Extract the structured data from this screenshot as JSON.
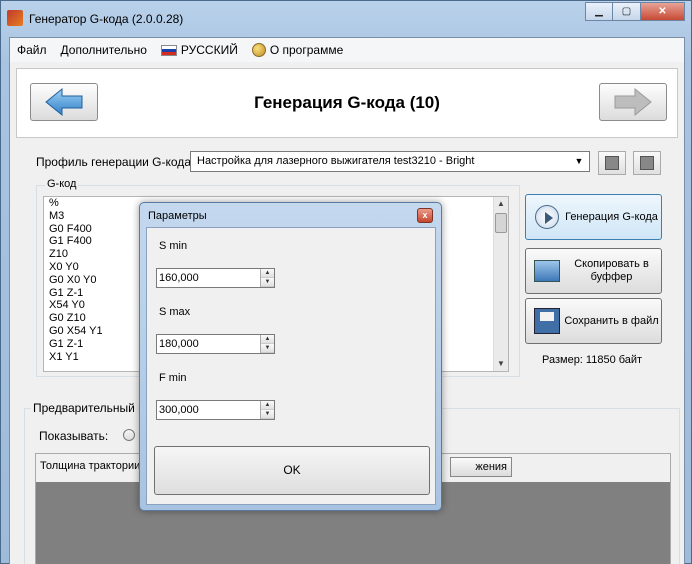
{
  "window": {
    "title": "Генератор G-кода (2.0.0.28)",
    "caption_minimize": "▁",
    "caption_maximize": "▢",
    "caption_close": "✕"
  },
  "menu": {
    "items": [
      "Файл",
      "Дополнительно",
      "РУССКИЙ",
      "О программе"
    ]
  },
  "header": {
    "title": "Генерация G-кода (10)"
  },
  "profile": {
    "label": "Профиль генерации G-кода:",
    "selected": "Настройка для лазерного выжигателя test3210 - Bright"
  },
  "gcode": {
    "group_label": "G-код",
    "lines": [
      "%",
      "M3",
      "G0 F400",
      "G1 F400",
      "Z10",
      "X0 Y0",
      "G0 X0  Y0",
      "G1 Z-1",
      "X54  Y0",
      "G0 Z10",
      "G0 X54  Y1",
      "G1 Z-1",
      "X1  Y1"
    ]
  },
  "actions": {
    "generate_label": "Генерация G-кода",
    "copy_label": "Скопировать в буффер",
    "save_label": "Сохранить в файл",
    "size_text": "Размер: 11850 байт"
  },
  "preview": {
    "group_label": "Предварительный пр",
    "show_label": "Показывать:",
    "thickness_label": "Толщина трактории:",
    "button_label": "жения"
  },
  "dialog": {
    "title": "Параметры",
    "close_glyph": "x",
    "s_min_label": "S min",
    "s_min_value": "160,000",
    "s_max_label": "S max",
    "s_max_value": "180,000",
    "f_min_label": "F min",
    "f_min_value": "300,000",
    "ok_label": "OK"
  }
}
